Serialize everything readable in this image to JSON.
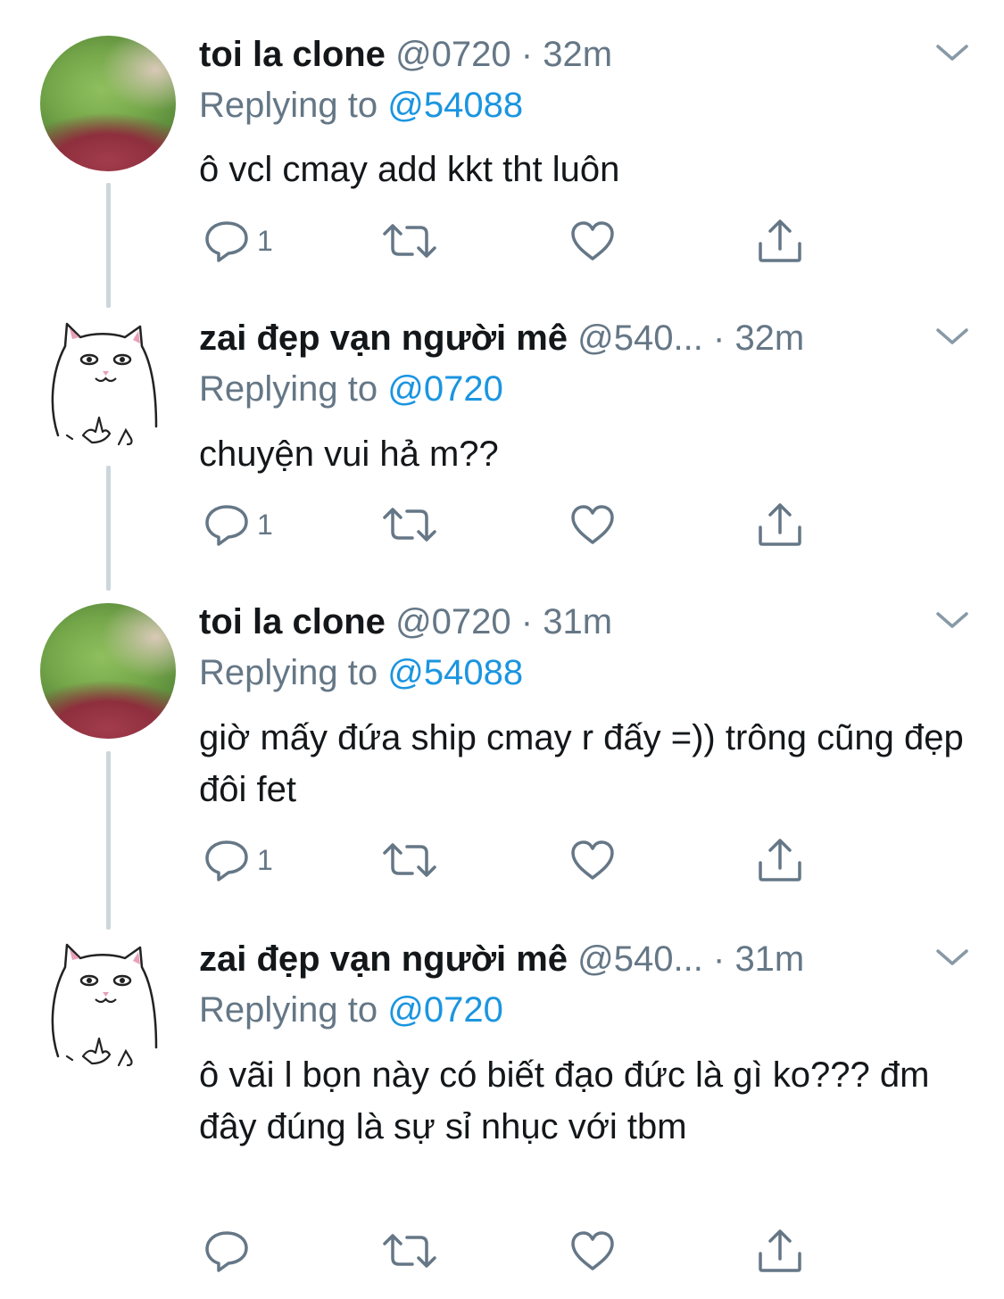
{
  "tweets": [
    {
      "name": "toi la clone",
      "handle": "@0720",
      "dot": "·",
      "time": "32m",
      "replying_prefix": "Replying to",
      "replying_to": "@54088",
      "text": "ô vcl cmay add kkt tht luôn",
      "reply_count": "1",
      "avatar": "green-blurry-avatar"
    },
    {
      "name": "zai đẹp vạn người mê",
      "handle": "@540...",
      "dot": "·",
      "time": "32m",
      "replying_prefix": "Replying to",
      "replying_to": "@0720",
      "text": "chuyện vui hả m??",
      "reply_count": "1",
      "avatar": "cat-middle-finger-avatar"
    },
    {
      "name": "toi la clone",
      "handle": "@0720",
      "dot": "·",
      "time": "31m",
      "replying_prefix": "Replying to",
      "replying_to": "@54088",
      "text": "giờ mấy đứa ship cmay r đấy =)) trông cũng đẹp đôi fet",
      "reply_count": "1",
      "avatar": "green-blurry-avatar"
    },
    {
      "name": "zai đẹp vạn người mê",
      "handle": "@540...",
      "dot": "·",
      "time": "31m",
      "replying_prefix": "Replying to",
      "replying_to": "@0720",
      "text": "ô vãi l bọn này có biết đạo đức là gì ko??? đm đây đúng là sự sỉ nhục với tbm",
      "reply_count": "",
      "avatar": "cat-middle-finger-avatar"
    }
  ],
  "icons": {
    "reply": "reply-icon",
    "retweet": "retweet-icon",
    "like": "heart-icon",
    "share": "share-icon",
    "menu": "chevron-down-icon"
  },
  "colors": {
    "link": "#1b95e0",
    "secondary": "#657786",
    "primary_text": "#14171a",
    "thread_line": "#ccd6dd"
  }
}
